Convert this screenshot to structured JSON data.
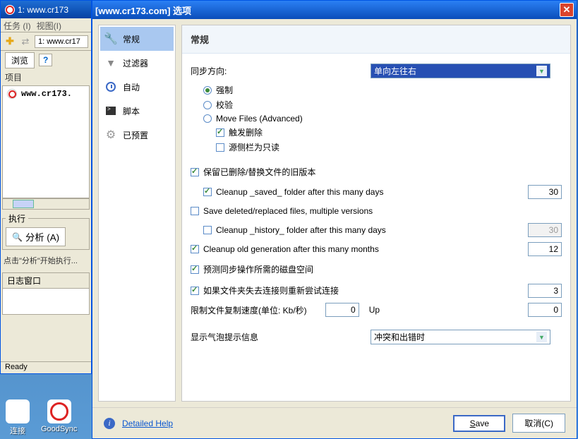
{
  "mainwin": {
    "title": "1: www.cr173",
    "menu": {
      "tasks": "任务 (I)",
      "view": "视图(I)"
    },
    "tab": "1: www.cr17",
    "browse": "浏览",
    "projects_label": "项目",
    "project_item": "www.cr173.",
    "exec_label": "执行",
    "analyze": "分析 (A)",
    "hint": "点击\"分析\"开始执行...",
    "log_label": "日志窗口",
    "status": "Ready"
  },
  "dialog": {
    "title": "[www.cr173.com] 选项",
    "sidebar": {
      "general": "常规",
      "filter": "过滤器",
      "auto": "自动",
      "script": "脚本",
      "preset": "已预置"
    },
    "heading": "常规",
    "syncdir_label": "同步方向:",
    "syncdir_value": "单向左往右",
    "radio_force": "强制",
    "radio_verify": "校验",
    "radio_move": "Move Files (Advanced)",
    "chk_trigdel": "触发删除",
    "chk_srcread": "源侧栏为只读",
    "chk_keepold": "保留已删除/替换文件的旧版本",
    "chk_cleansaved": "Cleanup _saved_ folder after this many days",
    "val_cleansaved": "30",
    "chk_savedelmulti": "Save deleted/replaced files, multiple versions",
    "chk_cleanhist": "Cleanup _history_ folder after this many days",
    "val_cleanhist": "30",
    "chk_cleanold": "Cleanup old generation after this many months",
    "val_cleanold": "12",
    "chk_predict": "预测同步操作所需的磁盘空间",
    "chk_retry": "如果文件夹失去连接则重新尝试连接",
    "val_retry": "3",
    "speed_label": "限制文件复制速度(单位: Kb/秒)",
    "speed_down": "0",
    "speed_up_label": "Up",
    "speed_up": "0",
    "balloon_label": "显示气泡提示信息",
    "balloon_value": "冲突和出错时",
    "help_link": "Detailed Help",
    "btn_save": "Save",
    "btn_cancel": "取消(C)"
  },
  "desktop": {
    "conn": "连接",
    "goodsync": "GoodSync"
  }
}
